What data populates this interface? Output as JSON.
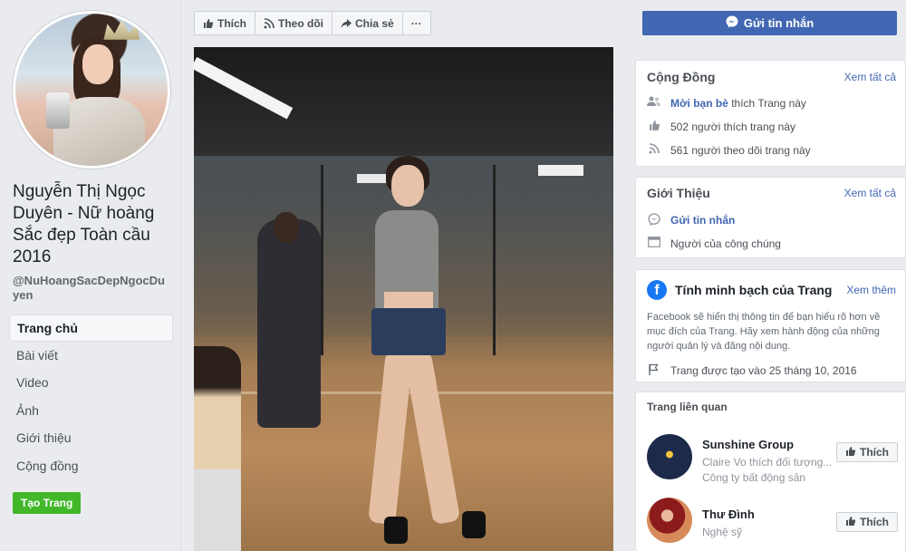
{
  "profile": {
    "name": "Nguyễn Thị Ngọc Duyên - Nữ hoàng Sắc đẹp Toàn cầu 2016",
    "handle": "@NuHoangSacDepNgocDuyen"
  },
  "nav": {
    "items": [
      "Trang chủ",
      "Bài viết",
      "Video",
      "Ảnh",
      "Giới thiệu",
      "Cộng đồng"
    ],
    "create_page": "Tạo Trang"
  },
  "actions": {
    "like": "Thích",
    "follow": "Theo dõi",
    "share": "Chia sẻ",
    "more": "···"
  },
  "send_message": "Gửi tin nhắn",
  "community": {
    "title": "Cộng Đồng",
    "see_all": "Xem tất cả",
    "invite_link": "Mời bạn bè",
    "invite_rest": "thích Trang này",
    "likes": "502 người thích trang này",
    "follows": "561 người theo dõi trang này"
  },
  "about": {
    "title": "Giới Thiệu",
    "see_all": "Xem tất cả",
    "send_message": "Gửi tin nhắn",
    "category": "Người của công chúng"
  },
  "transparency": {
    "title": "Tính minh bạch của Trang",
    "see_more": "Xem thêm",
    "description": "Facebook sẽ hiển thị thông tin để bạn hiểu rõ hơn về mục đích của Trang. Hãy xem hành động của những người quản lý và đăng nội dung.",
    "created": "Trang được tạo vào 25 tháng 10, 2016"
  },
  "related": {
    "title": "Trang liên quan",
    "items": [
      {
        "name": "Sunshine Group",
        "sub1": "Claire Vo thích đối tượng...",
        "sub2": "Công ty bất động sản",
        "like": "Thích"
      },
      {
        "name": "Thư Đình",
        "sub1": "Nghệ sỹ",
        "like": "Thích"
      }
    ]
  },
  "icons": {
    "like": "thumbs-up-icon",
    "follow": "rss-icon",
    "share": "share-arrow-icon",
    "messenger": "messenger-icon"
  },
  "colors": {
    "brand_blue": "#4267b2",
    "create_green": "#42b72a",
    "background": "#e9ebee"
  }
}
